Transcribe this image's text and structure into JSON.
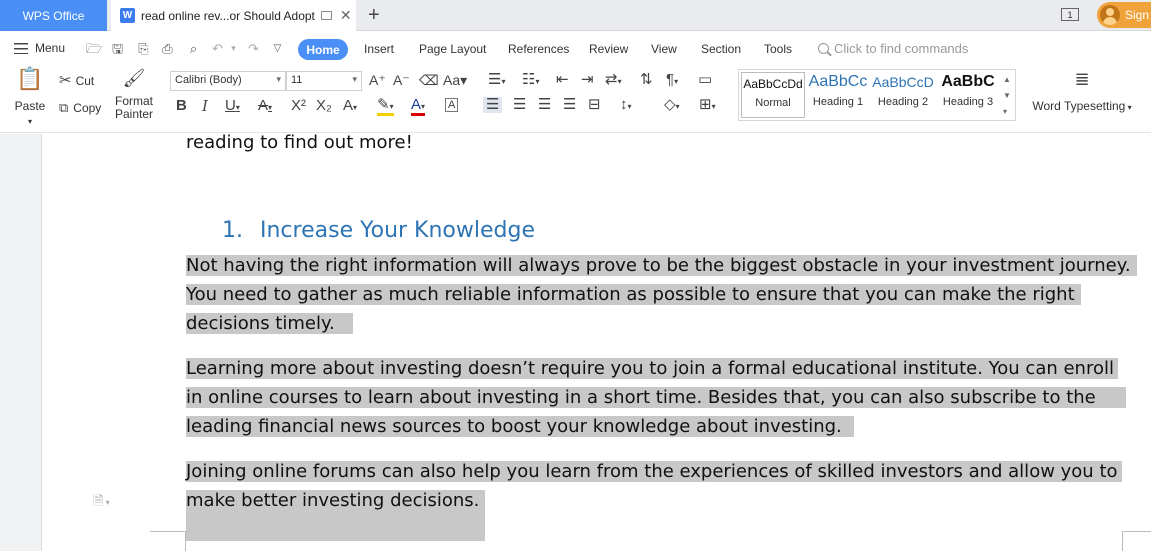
{
  "titlebar": {
    "app_tab": "WPS Office",
    "doc_tab": "read online rev...or Should Adopt",
    "doc_icon_letter": "W",
    "sign_label": "Sign",
    "window_badge": "1"
  },
  "menubar": {
    "menu_label": "Menu",
    "tabs": [
      "Home",
      "Insert",
      "Page Layout",
      "References",
      "Review",
      "View",
      "Section",
      "Tools"
    ],
    "search_placeholder": "Click to find commands"
  },
  "ribbon": {
    "paste": "Paste",
    "cut": "Cut",
    "copy": "Copy",
    "format_painter_1": "Format",
    "format_painter_2": "Painter",
    "font_name": "Calibri (Body)",
    "font_size": "11",
    "styles": [
      {
        "preview": "AaBbCcDd",
        "name": "Normal"
      },
      {
        "preview": "AaBbCc",
        "name": "Heading 1"
      },
      {
        "preview": "AaBbCcD",
        "name": "Heading 2"
      },
      {
        "preview": "AaBbC",
        "name": "Heading 3"
      }
    ],
    "word_typesetting": "Word Typesetting"
  },
  "document": {
    "intro_tail": "reading to find out more!",
    "heading_number": "1.",
    "heading_text": "Increase Your Knowledge",
    "p1": [
      "Not having the right information will always prove to be the biggest obstacle in your investment journey.",
      "You need to gather as much reliable information as possible to ensure that you can make the right",
      "decisions timely."
    ],
    "p2": [
      "Learning more about investing doesn’t require you to join a formal educational institute. You can enroll",
      "in online courses to learn about investing in a short time. Besides that, you can also subscribe to the",
      "leading financial news sources to boost your knowledge about investing."
    ],
    "p3": [
      "Joining online forums can also help you learn from the experiences of skilled investors and allow you to",
      "make better investing decisions."
    ]
  },
  "colors": {
    "accent": "#4a8ff5",
    "heading": "#2e74b5",
    "selection": "#c8c8c8",
    "sign": "#f1a33b"
  }
}
